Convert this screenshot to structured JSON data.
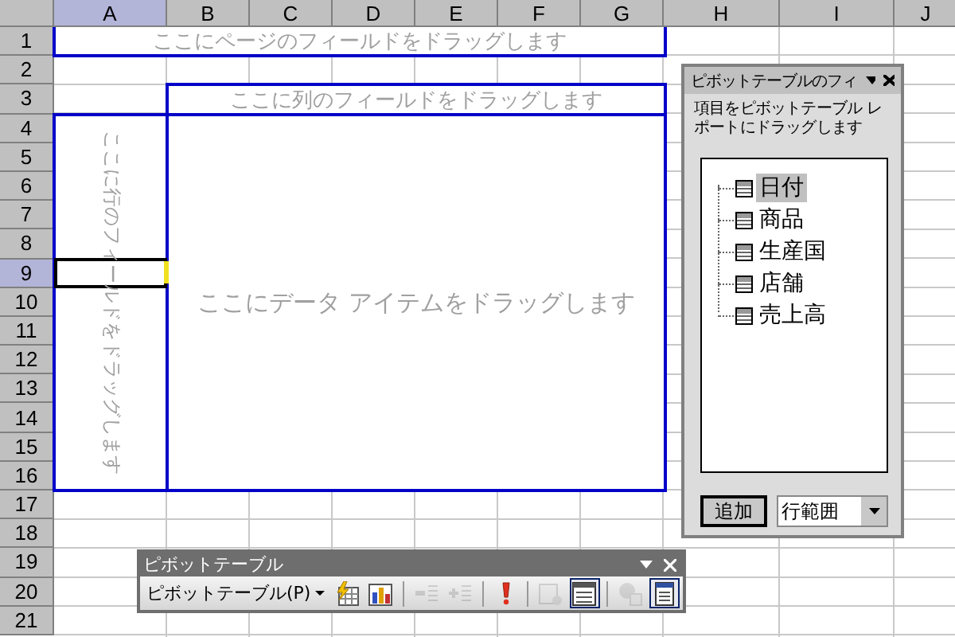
{
  "sheet": {
    "columns": [
      {
        "label": "A",
        "selected": true
      },
      {
        "label": "B",
        "selected": false
      },
      {
        "label": "C",
        "selected": false
      },
      {
        "label": "D",
        "selected": false
      },
      {
        "label": "E",
        "selected": false
      },
      {
        "label": "F",
        "selected": false
      },
      {
        "label": "G",
        "selected": false
      },
      {
        "label": "H",
        "selected": false
      },
      {
        "label": "I",
        "selected": false
      },
      {
        "label": "J",
        "selected": false
      }
    ],
    "rows": [
      {
        "label": "1",
        "selected": false
      },
      {
        "label": "2",
        "selected": false
      },
      {
        "label": "3",
        "selected": false
      },
      {
        "label": "4",
        "selected": false
      },
      {
        "label": "5",
        "selected": false
      },
      {
        "label": "6",
        "selected": false
      },
      {
        "label": "7",
        "selected": false
      },
      {
        "label": "8",
        "selected": false
      },
      {
        "label": "9",
        "selected": true
      },
      {
        "label": "10",
        "selected": false
      },
      {
        "label": "11",
        "selected": false
      },
      {
        "label": "12",
        "selected": false
      },
      {
        "label": "13",
        "selected": false
      },
      {
        "label": "14",
        "selected": false
      },
      {
        "label": "15",
        "selected": false
      },
      {
        "label": "16",
        "selected": false
      },
      {
        "label": "17",
        "selected": false
      },
      {
        "label": "18",
        "selected": false
      },
      {
        "label": "19",
        "selected": false
      },
      {
        "label": "20",
        "selected": false
      },
      {
        "label": "21",
        "selected": false
      }
    ]
  },
  "pivot_areas": {
    "page_drop": "ここにページのフィールドをドラッグします",
    "column_drop": "ここに列のフィールドをドラッグします",
    "row_drop": "ここに行のフィールドをドラッグします",
    "data_drop": "ここにデータ アイテムをドラッグします"
  },
  "field_list": {
    "title": "ピボットテーブルのフィ",
    "instruction": "項目をピボットテーブル レポートにドラッグします",
    "fields": [
      {
        "label": "日付",
        "selected": true
      },
      {
        "label": "商品",
        "selected": false
      },
      {
        "label": "生産国",
        "selected": false
      },
      {
        "label": "店舗",
        "selected": false
      },
      {
        "label": "売上高",
        "selected": false
      }
    ],
    "add_button": "追加",
    "area_select": "行範囲"
  },
  "toolbar": {
    "title": "ピボットテーブル",
    "menu": "ピボットテーブル(P)",
    "buttons": [
      {
        "kind": "format",
        "disabled": false,
        "pressed": false
      },
      {
        "kind": "chart",
        "disabled": false,
        "pressed": false
      },
      {
        "kind": "separator"
      },
      {
        "kind": "hide_detail",
        "disabled": true,
        "pressed": false
      },
      {
        "kind": "show_detail",
        "disabled": true,
        "pressed": false
      },
      {
        "kind": "separator"
      },
      {
        "kind": "refresh",
        "disabled": false,
        "pressed": false
      },
      {
        "kind": "separator"
      },
      {
        "kind": "field_settings",
        "disabled": true,
        "pressed": false
      },
      {
        "kind": "field_list",
        "disabled": false,
        "pressed": true
      },
      {
        "kind": "separator"
      },
      {
        "kind": "cell_options",
        "disabled": true,
        "pressed": false
      },
      {
        "kind": "always_show",
        "disabled": false,
        "pressed": true
      }
    ]
  }
}
